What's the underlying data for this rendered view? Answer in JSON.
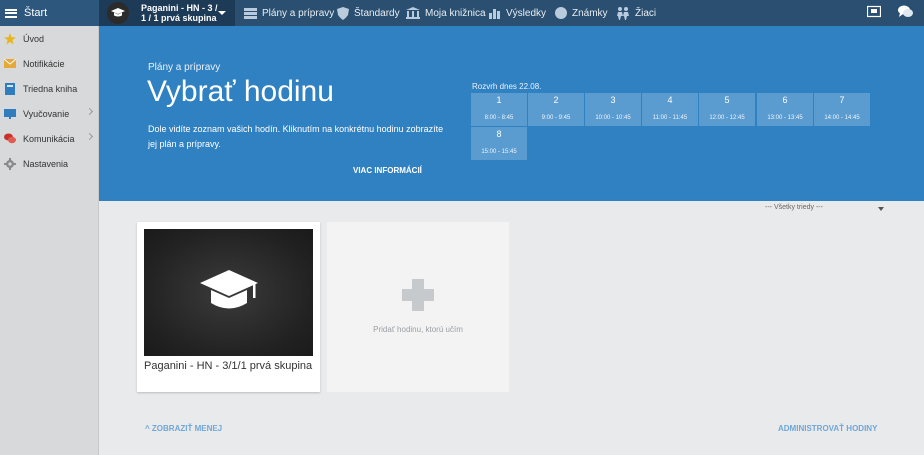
{
  "topbar": {
    "start_label": "Štart",
    "course_line1": "Paganini - HN - 3 /",
    "course_line2": "1 / 1 prvá skupina",
    "nav": [
      "Plány a prípravy",
      "Štandardy",
      "Moja knižnica",
      "Výsledky",
      "Známky",
      "Žiaci"
    ]
  },
  "sidebar": {
    "items": [
      "Úvod",
      "Notifikácie",
      "Triedna kniha",
      "Vyučovanie",
      "Komunikácia",
      "Nastavenia"
    ]
  },
  "hero": {
    "subtitle": "Plány a prípravy",
    "title": "Vybrať hodinu",
    "description": "Dole vidíte zoznam vašich hodín. Kliknutím na konkrétnu hodinu zobrazíte jej plán a prípravy.",
    "more_link": "VIAC INFORMÁCIÍ",
    "schedule_label": "Rozvrh dnes 22.08.",
    "slots": [
      {
        "num": "1",
        "time": "8:00 - 8:45"
      },
      {
        "num": "2",
        "time": "9:00 - 9:45"
      },
      {
        "num": "3",
        "time": "10:00 - 10:45"
      },
      {
        "num": "4",
        "time": "11:00 - 11:45"
      },
      {
        "num": "5",
        "time": "12:00 - 12:45"
      },
      {
        "num": "6",
        "time": "13:00 - 13:45"
      },
      {
        "num": "7",
        "time": "14:00 - 14:45"
      },
      {
        "num": "8",
        "time": "15:00 - 15:45"
      }
    ]
  },
  "filter": {
    "selected": "--- Všetky triedy ---"
  },
  "card": {
    "name": "Paganini - HN - 3/1/1 prvá skupina"
  },
  "add_card": {
    "label": "Pridať hodinu, ktorú učím"
  },
  "footer": {
    "show_less": "ZOBRAZIŤ MENEJ",
    "admin": "ADMINISTROVAŤ HODINY"
  },
  "colors": {
    "topbar": "#2a4f70",
    "hero": "#3081c2",
    "slot": "#5a9bd0",
    "link": "#6fa7d8"
  }
}
